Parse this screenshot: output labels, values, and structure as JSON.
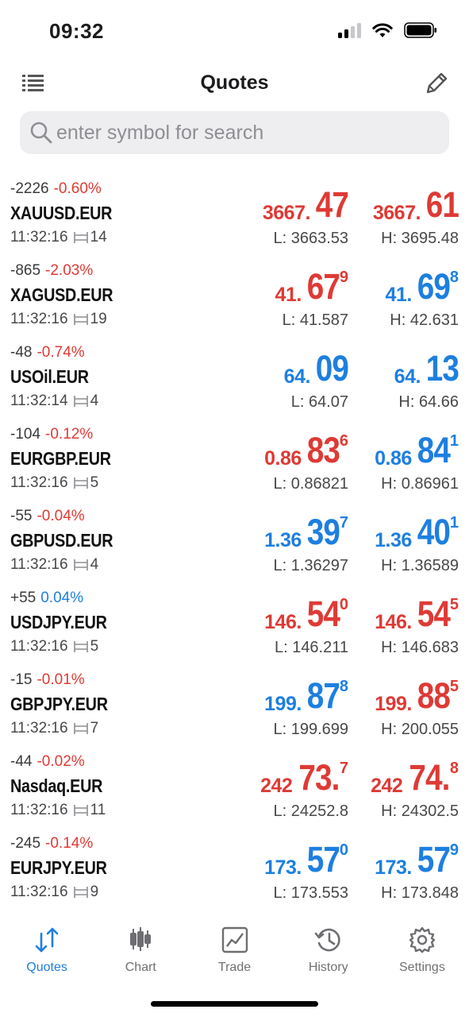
{
  "status_bar": {
    "time": "09:32"
  },
  "nav": {
    "title": "Quotes"
  },
  "search": {
    "placeholder": "enter symbol for search"
  },
  "colors": {
    "down": "#de3a35",
    "up": "#1d7fe0"
  },
  "quotes": [
    {
      "change_points": "-2226",
      "change_percent": "-0.60%",
      "change_color": "red",
      "symbol": "XAUUSD.EUR",
      "time": "11:32:16",
      "spread": "14",
      "bid": {
        "small": "3667.",
        "big": "47",
        "sup": "",
        "color": "red"
      },
      "ask": {
        "small": "3667.",
        "big": "61",
        "sup": "",
        "color": "red"
      },
      "low": "L: 3663.53",
      "high": "H: 3695.48"
    },
    {
      "change_points": "-865",
      "change_percent": "-2.03%",
      "change_color": "red",
      "symbol": "XAGUSD.EUR",
      "time": "11:32:16",
      "spread": "19",
      "bid": {
        "small": "41.",
        "big": "67",
        "sup": "9",
        "color": "red"
      },
      "ask": {
        "small": "41.",
        "big": "69",
        "sup": "8",
        "color": "blue"
      },
      "low": "L: 41.587",
      "high": "H: 42.631"
    },
    {
      "change_points": "-48",
      "change_percent": "-0.74%",
      "change_color": "red",
      "symbol": "USOil.EUR",
      "time": "11:32:14",
      "spread": "4",
      "bid": {
        "small": "64.",
        "big": "09",
        "sup": "",
        "color": "blue"
      },
      "ask": {
        "small": "64.",
        "big": "13",
        "sup": "",
        "color": "blue"
      },
      "low": "L: 64.07",
      "high": "H: 64.66"
    },
    {
      "change_points": "-104",
      "change_percent": "-0.12%",
      "change_color": "red",
      "symbol": "EURGBP.EUR",
      "time": "11:32:16",
      "spread": "5",
      "bid": {
        "small": "0.86",
        "big": "83",
        "sup": "6",
        "color": "red"
      },
      "ask": {
        "small": "0.86",
        "big": "84",
        "sup": "1",
        "color": "blue"
      },
      "low": "L: 0.86821",
      "high": "H: 0.86961"
    },
    {
      "change_points": "-55",
      "change_percent": "-0.04%",
      "change_color": "red",
      "symbol": "GBPUSD.EUR",
      "time": "11:32:16",
      "spread": "4",
      "bid": {
        "small": "1.36",
        "big": "39",
        "sup": "7",
        "color": "blue"
      },
      "ask": {
        "small": "1.36",
        "big": "40",
        "sup": "1",
        "color": "blue"
      },
      "low": "L: 1.36297",
      "high": "H: 1.36589"
    },
    {
      "change_points": "+55",
      "change_percent": "0.04%",
      "change_color": "blue",
      "symbol": "USDJPY.EUR",
      "time": "11:32:16",
      "spread": "5",
      "bid": {
        "small": "146.",
        "big": "54",
        "sup": "0",
        "color": "red"
      },
      "ask": {
        "small": "146.",
        "big": "54",
        "sup": "5",
        "color": "red"
      },
      "low": "L: 146.211",
      "high": "H: 146.683"
    },
    {
      "change_points": "-15",
      "change_percent": "-0.01%",
      "change_color": "red",
      "symbol": "GBPJPY.EUR",
      "time": "11:32:16",
      "spread": "7",
      "bid": {
        "small": "199.",
        "big": "87",
        "sup": "8",
        "color": "blue"
      },
      "ask": {
        "small": "199.",
        "big": "88",
        "sup": "5",
        "color": "red"
      },
      "low": "L: 199.699",
      "high": "H: 200.055"
    },
    {
      "change_points": "-44",
      "change_percent": "-0.02%",
      "change_color": "red",
      "symbol": "Nasdaq.EUR",
      "time": "11:32:16",
      "spread": "11",
      "bid": {
        "small": "242",
        "big": "73.",
        "sup": "7",
        "color": "red"
      },
      "ask": {
        "small": "242",
        "big": "74.",
        "sup": "8",
        "color": "red"
      },
      "low": "L: 24252.8",
      "high": "H: 24302.5"
    },
    {
      "change_points": "-245",
      "change_percent": "-0.14%",
      "change_color": "red",
      "symbol": "EURJPY.EUR",
      "time": "11:32:16",
      "spread": "9",
      "bid": {
        "small": "173.",
        "big": "57",
        "sup": "0",
        "color": "blue"
      },
      "ask": {
        "small": "173.",
        "big": "57",
        "sup": "9",
        "color": "blue"
      },
      "low": "L: 173.553",
      "high": "H: 173.848"
    }
  ],
  "tabs": [
    {
      "label": "Quotes",
      "icon": "quotes-arrows-icon",
      "active": true
    },
    {
      "label": "Chart",
      "icon": "candlestick-icon",
      "active": false
    },
    {
      "label": "Trade",
      "icon": "trade-chart-icon",
      "active": false
    },
    {
      "label": "History",
      "icon": "history-clock-icon",
      "active": false
    },
    {
      "label": "Settings",
      "icon": "gear-icon",
      "active": false
    }
  ]
}
